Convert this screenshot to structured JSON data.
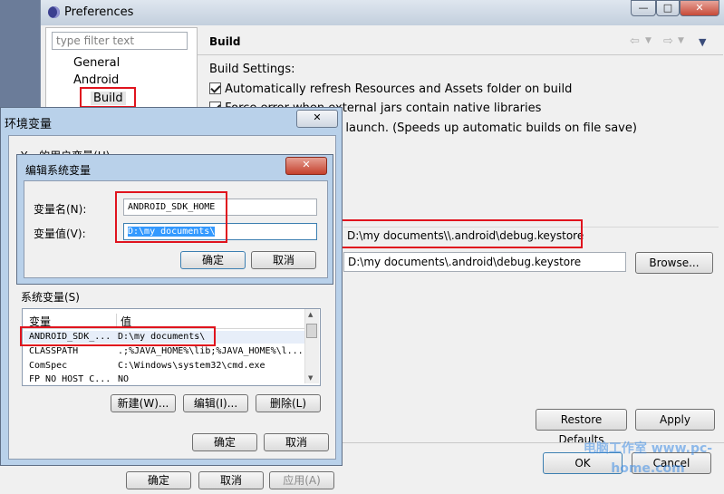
{
  "prefs": {
    "title": "Preferences",
    "filter_placeholder": "type filter text",
    "tree": [
      "General",
      "Android",
      "Build"
    ],
    "page_title": "Build",
    "build_settings_label": "Build Settings:",
    "options": [
      "Automatically refresh Resources and Assets folder on build",
      "Force error when external jars contain native libraries",
      "...ing until export or launch. (Speeds up automatic builds on file save)"
    ],
    "default_keystore": "D:\\my documents\\\\.android\\debug.keystore",
    "custom_keystore": "D:\\my documents\\.android\\debug.keystore",
    "browse": "Browse...",
    "restore_defaults": "Restore Defaults",
    "apply": "Apply",
    "ok": "OK",
    "cancel": "Cancel"
  },
  "env": {
    "title": "环境变量",
    "user_vars_label": "Y... 的用户变量(U)",
    "system_vars_label": "系统变量(S)",
    "col_var": "变量",
    "col_val": "值",
    "rows": [
      {
        "name": "ANDROID_SDK_...",
        "value": "D:\\my documents\\"
      },
      {
        "name": "CLASSPATH",
        "value": ".;%JAVA_HOME%\\lib;%JAVA_HOME%\\l..."
      },
      {
        "name": "ComSpec",
        "value": "C:\\Windows\\system32\\cmd.exe"
      },
      {
        "name": "FP_NO_HOST_C...",
        "value": "NO"
      }
    ],
    "new_btn": "新建(W)...",
    "edit_btn": "编辑(I)...",
    "delete_btn": "删除(L)",
    "ok": "确定",
    "cancel": "取消"
  },
  "edit": {
    "title": "编辑系统变量",
    "name_label": "变量名(N):",
    "value_label": "变量值(V):",
    "name_value": "ANDROID_SDK_HOME",
    "value_value": "D:\\my documents\\",
    "ok": "确定",
    "cancel": "取消"
  },
  "sysprops": {
    "ok": "确定",
    "cancel": "取消",
    "apply": "应用(A)"
  },
  "watermark": "电脑工作室 www.pc-home.com",
  "colors": {
    "highlight": "#e0141e",
    "selection": "#3399ff",
    "dialog_bg": "#f0f0f0"
  }
}
